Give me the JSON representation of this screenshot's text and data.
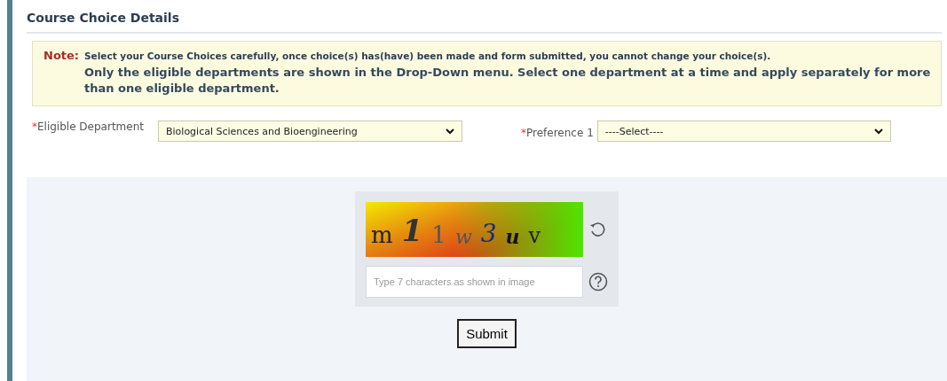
{
  "section": {
    "title": "Course Choice Details"
  },
  "note": {
    "label": "Note:",
    "line_1": "Select your Course Choices carefully, once choice(s) has(have) been made and form submitted, you cannot change your choice(s).",
    "line_2": "Only the eligible departments are shown in the Drop-Down menu. Select one department at a time and apply separately for more than one eligible department."
  },
  "fields": [
    {
      "required_mark": "*",
      "label": "Eligible Department",
      "value": "Biological Sciences and Bioengineering"
    },
    {
      "required_mark": "*",
      "label": "Preference 1",
      "value": "----Select----"
    }
  ],
  "captcha": {
    "characters": [
      "m",
      "1",
      "1",
      "w",
      "3",
      "u",
      "v"
    ],
    "placeholder": "Type 7 characters as shown in image"
  },
  "submit": "Submit"
}
